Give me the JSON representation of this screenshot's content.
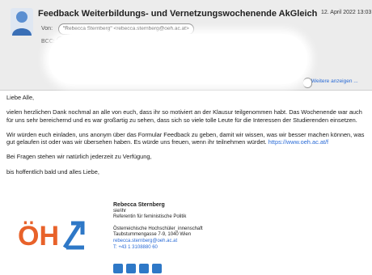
{
  "message": {
    "subject": "Feedback Weiterbildungs- und Vernetzungswochenende AkGleich",
    "date": "12. April 2022 13:03",
    "from_label": "Von:",
    "from_value": "\"Rebecca Sternberg\" <rebecca.sternberg@oeh.ac.at>",
    "bcc_label": "BCC:",
    "show_more": "Weitere anzeigen ..."
  },
  "body": {
    "greeting": "Liebe Alle,",
    "p1": "vielen herzlichen Dank nochmal an alle von euch, dass ihr so motiviert an der Klausur teilgenommen habt. Das Wochenende war auch für uns sehr bereichernd und es war großartig zu sehen, dass sich so viele tolle Leute für die Interessen der Studierenden einsetzen.",
    "p2": "Wir würden euch einladen, uns anonym über das Formular Feedback zu geben, damit wir wissen, was wir besser machen können, was gut gelaufen ist oder was wir übersehen haben. Es würde uns freuen, wenn ihr teilnehmen würdet.",
    "p2_link": "https://www.oeh.ac.at/f",
    "p3": "Bei Fragen stehen wir natürlich jederzeit zu Verfügung,",
    "p4": "bis hoffentlich bald und alles Liebe,"
  },
  "signature": {
    "name": "Rebecca Sternberg",
    "pronouns": "sie/ihr",
    "role": "Referentin für feministische Politik",
    "org": "Österreichische Hochschüler_innenschaft",
    "address": "Taubstummengasse 7-9, 1040 Wien",
    "email": "rebecca.sternberg@oeh.ac.at",
    "phone": "T: +43 1 3108880 60",
    "logo_text": "ÖH"
  },
  "colors": {
    "logo_orange": "#e8622a",
    "logo_blue": "#2e78c7",
    "link": "#2a6bd6"
  },
  "icons": [
    "contact-avatar-icon",
    "web-icon",
    "facebook-icon",
    "instagram-icon",
    "twitter-icon"
  ]
}
